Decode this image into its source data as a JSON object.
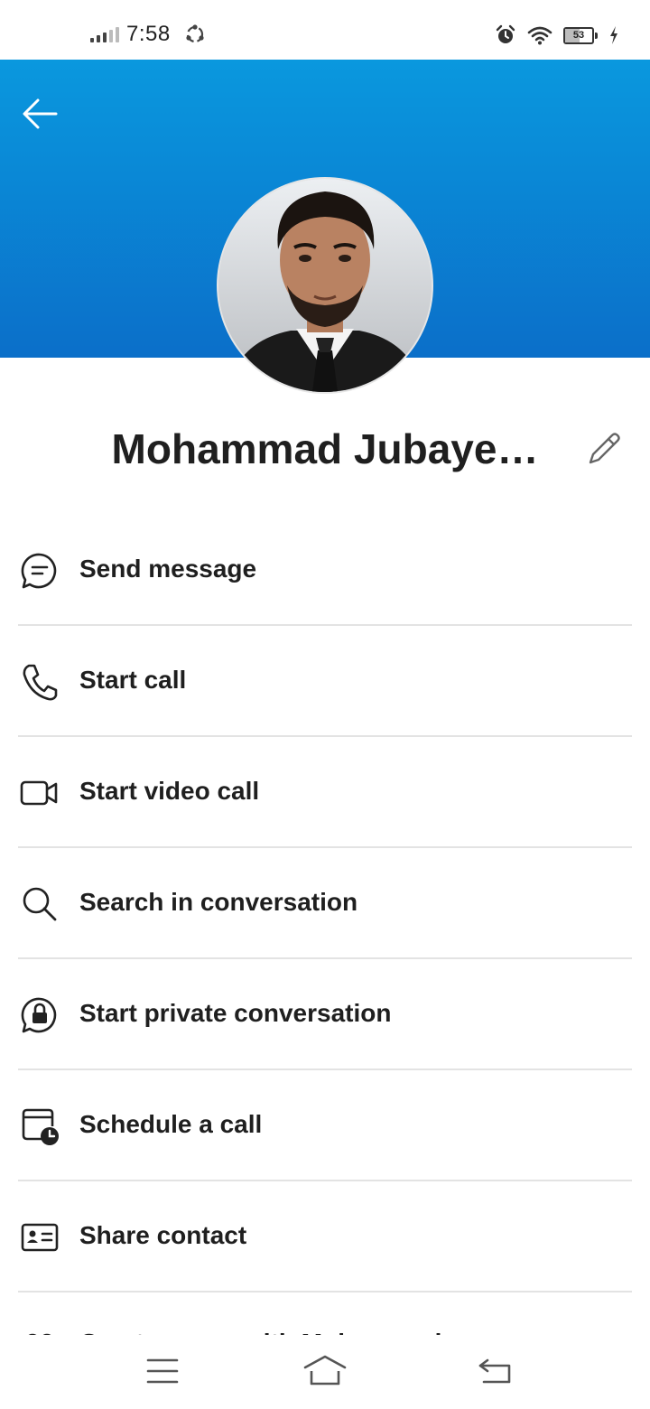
{
  "status_bar": {
    "time": "7:58",
    "battery_level": "53",
    "icons": [
      "signal-icon",
      "sync-icon",
      "alarm-icon",
      "wifi-icon",
      "battery-icon",
      "charging-icon"
    ]
  },
  "header": {
    "back_icon": "arrow-left-icon",
    "colors": {
      "gradient_top": "#0a98de",
      "gradient_bottom": "#0b6fc9"
    }
  },
  "profile": {
    "name": "Mohammad Jubaye…",
    "edit_icon": "pencil-icon"
  },
  "actions": [
    {
      "label": "Send message",
      "icon": "chat-bubble-icon"
    },
    {
      "label": "Start call",
      "icon": "phone-icon"
    },
    {
      "label": "Start video call",
      "icon": "video-camera-icon"
    },
    {
      "label": "Search in conversation",
      "icon": "search-icon"
    },
    {
      "label": "Start private conversation",
      "icon": "lock-chat-icon"
    },
    {
      "label": "Schedule a call",
      "icon": "calendar-clock-icon"
    },
    {
      "label": "Share contact",
      "icon": "contact-card-icon"
    },
    {
      "label": "Create group with Mohammad",
      "icon": "group-add-icon"
    }
  ],
  "nav_bar": {
    "icons": [
      "menu-icon",
      "home-icon",
      "back-icon"
    ]
  }
}
